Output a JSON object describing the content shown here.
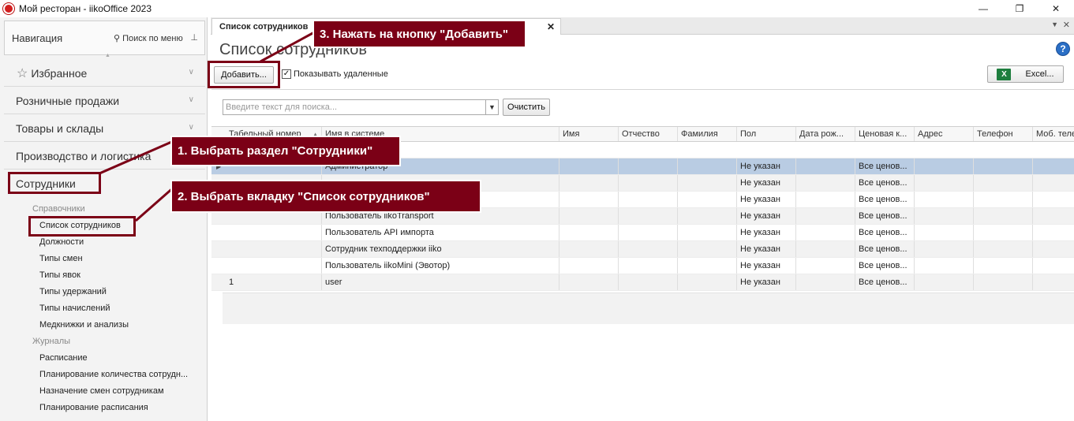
{
  "window": {
    "title": "Мой ресторан - iikoOffice 2023",
    "controls": [
      "—",
      "❐",
      "✕"
    ]
  },
  "nav": {
    "header": "Навигация",
    "search_label": "Поиск по меню",
    "sections": {
      "favorites": "Избранное",
      "retail": "Розничные продажи",
      "goods": "Товары и склады",
      "production": "Производство и логистика",
      "employees": "Сотрудники"
    },
    "groups": {
      "references": "Справочники",
      "journals": "Журналы"
    },
    "reference_items": [
      "Список сотрудников",
      "Должности",
      "Типы смен",
      "Типы явок",
      "Типы удержаний",
      "Типы начислений",
      "Медкнижки и анализы"
    ],
    "journal_items": [
      "Расписание",
      "Планирование количества сотрудн...",
      "Назначение смен сотрудникам",
      "Планирование расписания"
    ]
  },
  "tab": {
    "label": "Список сотрудников"
  },
  "main": {
    "title": "Список сотрудников",
    "add_button": "Добавить...",
    "show_deleted_label": "Показывать удаленные",
    "show_deleted_checked": true,
    "excel_button": "Excel...",
    "search_placeholder": "Введите текст для поиска...",
    "clear_button": "Очистить"
  },
  "table": {
    "columns": [
      "Табельный номер",
      "Имя в системе",
      "Имя",
      "Отчество",
      "Фамилия",
      "Пол",
      "Дата рож...",
      "Ценовая к...",
      "Адрес",
      "Телефон",
      "Моб. теле"
    ],
    "rows": [
      [
        "",
        "Администратор",
        "",
        "",
        "",
        "Не указан",
        "",
        "Все ценов...",
        "",
        "",
        ""
      ],
      [
        "",
        "",
        "",
        "",
        "",
        "Не указан",
        "",
        "Все ценов...",
        "",
        "",
        ""
      ],
      [
        "",
        "доставки",
        "",
        "",
        "",
        "Не указан",
        "",
        "Все ценов...",
        "",
        "",
        ""
      ],
      [
        "",
        "Пользователь iikoTransport",
        "",
        "",
        "",
        "Не указан",
        "",
        "Все ценов...",
        "",
        "",
        ""
      ],
      [
        "",
        "Пользователь API импорта",
        "",
        "",
        "",
        "Не указан",
        "",
        "Все ценов...",
        "",
        "",
        ""
      ],
      [
        "",
        "Сотрудник техподдержки iiko",
        "",
        "",
        "",
        "Не указан",
        "",
        "Все ценов...",
        "",
        "",
        ""
      ],
      [
        "",
        "Пользователь iikoMini (Эвотор)",
        "",
        "",
        "",
        "Не указан",
        "",
        "Все ценов...",
        "",
        "",
        ""
      ],
      [
        "1",
        "user",
        "",
        "",
        "",
        "Не указан",
        "",
        "Все ценов...",
        "",
        "",
        ""
      ]
    ]
  },
  "annotations": {
    "step1": "1. Выбрать раздел \"Сотрудники\"",
    "step2": "2. Выбрать вкладку \"Список сотрудников\"",
    "step3": "3. Нажать на кнопку \"Добавить\""
  },
  "colors": {
    "annotation": "#7b0016",
    "selected_row": "#b9cce3"
  }
}
